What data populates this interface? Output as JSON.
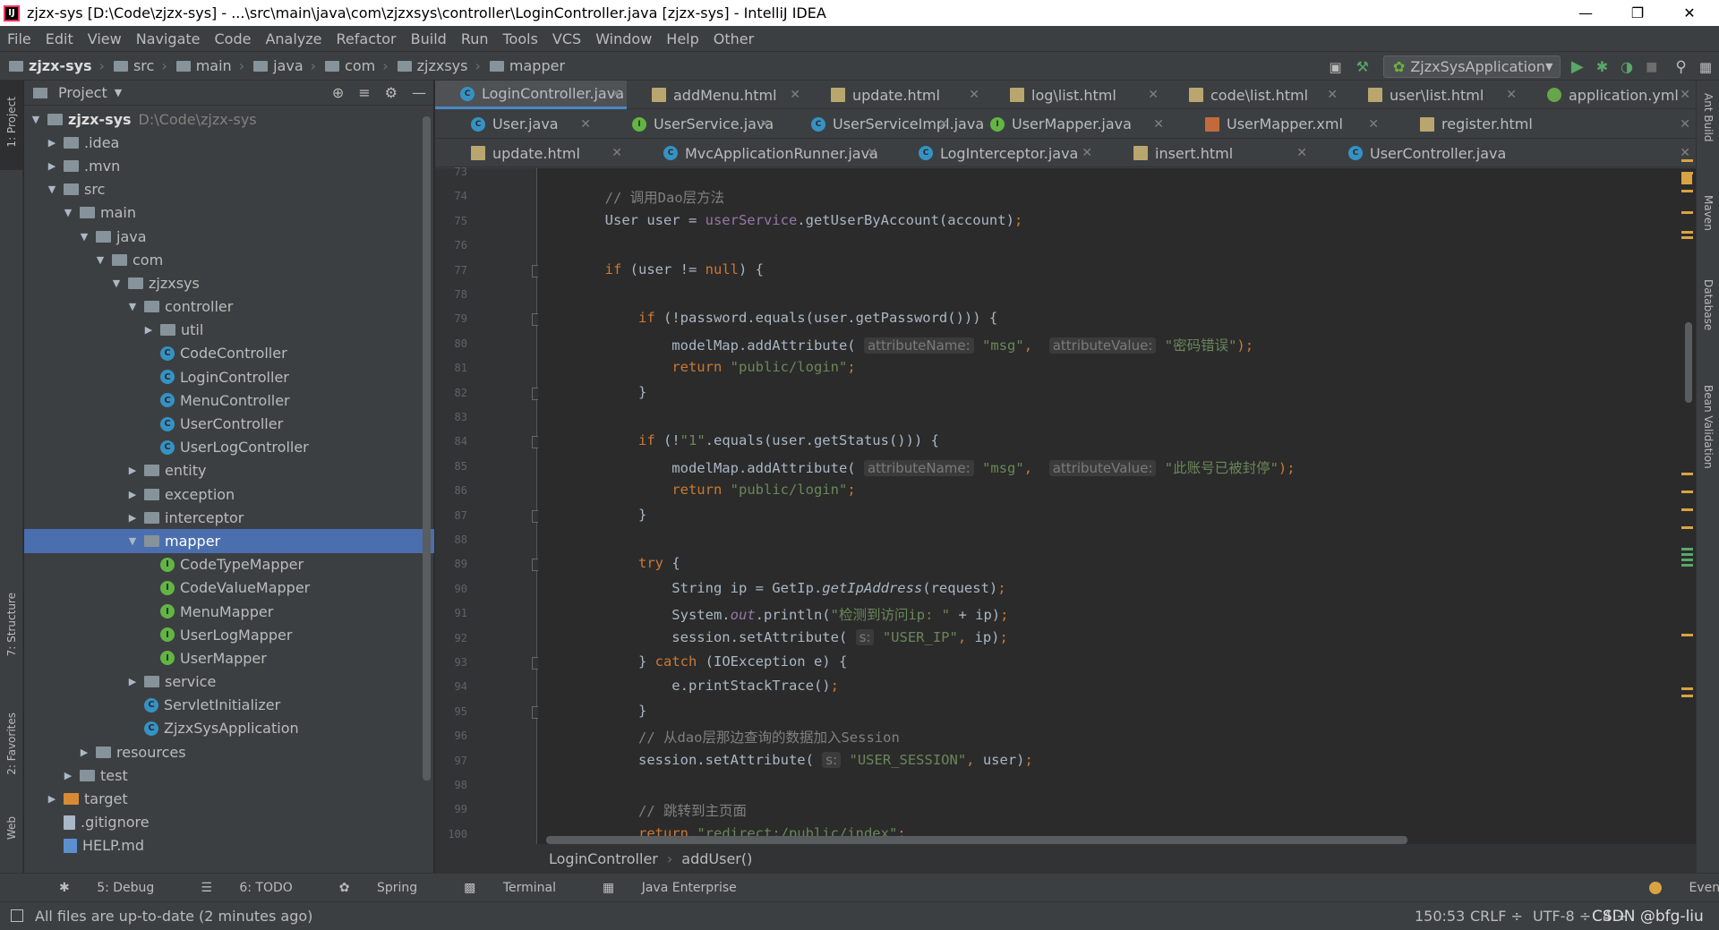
{
  "window": {
    "title": "zjzx-sys [D:\\Code\\zjzx-sys] - ...\\src\\main\\java\\com\\zjzxsys\\controller\\LoginController.java [zjzx-sys] - IntelliJ IDEA",
    "app_logo": "IJ"
  },
  "menu": [
    "File",
    "Edit",
    "View",
    "Navigate",
    "Code",
    "Analyze",
    "Refactor",
    "Build",
    "Run",
    "Tools",
    "VCS",
    "Window",
    "Help",
    "Other"
  ],
  "breadcrumb": [
    "zjzx-sys",
    "src",
    "main",
    "java",
    "com",
    "zjzxsys",
    "mapper"
  ],
  "run_config": "ZjzxSysApplication",
  "left_strip": [
    "1: Project",
    "7: Structure",
    "2: Favorites",
    "Web"
  ],
  "right_strip": [
    "Ant Build",
    "Maven",
    "Database",
    "Bean Validation"
  ],
  "project": {
    "title": "Project",
    "tree": [
      {
        "label": "zjzx-sys",
        "sub": "D:\\Code\\zjzx-sys",
        "arrow": "▼",
        "icon": "folder",
        "bold": true
      },
      {
        "label": ".idea",
        "arrow": "▶",
        "icon": "folder"
      },
      {
        "label": ".mvn",
        "arrow": "▶",
        "icon": "folder"
      },
      {
        "label": "src",
        "arrow": "▼",
        "icon": "folder"
      },
      {
        "label": "main",
        "arrow": "▼",
        "icon": "folder"
      },
      {
        "label": "java",
        "arrow": "▼",
        "icon": "folder"
      },
      {
        "label": "com",
        "arrow": "▼",
        "icon": "folder"
      },
      {
        "label": "zjzxsys",
        "arrow": "▼",
        "icon": "folder"
      },
      {
        "label": "controller",
        "arrow": "▼",
        "icon": "folder"
      },
      {
        "label": "util",
        "arrow": "▶",
        "icon": "folder"
      },
      {
        "label": "CodeController",
        "arrow": "",
        "icon": "cls"
      },
      {
        "label": "LoginController",
        "arrow": "",
        "icon": "cls"
      },
      {
        "label": "MenuController",
        "arrow": "",
        "icon": "cls"
      },
      {
        "label": "UserController",
        "arrow": "",
        "icon": "cls"
      },
      {
        "label": "UserLogController",
        "arrow": "",
        "icon": "cls"
      },
      {
        "label": "entity",
        "arrow": "▶",
        "icon": "folder"
      },
      {
        "label": "exception",
        "arrow": "▶",
        "icon": "folder"
      },
      {
        "label": "interceptor",
        "arrow": "▶",
        "icon": "folder"
      },
      {
        "label": "mapper",
        "arrow": "▼",
        "icon": "folder",
        "selected": true
      },
      {
        "label": "CodeTypeMapper",
        "arrow": "",
        "icon": "intf"
      },
      {
        "label": "CodeValueMapper",
        "arrow": "",
        "icon": "intf"
      },
      {
        "label": "MenuMapper",
        "arrow": "",
        "icon": "intf"
      },
      {
        "label": "UserLogMapper",
        "arrow": "",
        "icon": "intf"
      },
      {
        "label": "UserMapper",
        "arrow": "",
        "icon": "intf"
      },
      {
        "label": "service",
        "arrow": "▶",
        "icon": "folder"
      },
      {
        "label": "ServletInitializer",
        "arrow": "",
        "icon": "cls"
      },
      {
        "label": "ZjzxSysApplication",
        "arrow": "",
        "icon": "cls"
      },
      {
        "label": "resources",
        "arrow": "▶",
        "icon": "folder"
      },
      {
        "label": "test",
        "arrow": "▶",
        "icon": "folder"
      },
      {
        "label": "target",
        "arrow": "▶",
        "icon": "folder-orange"
      },
      {
        "label": ".gitignore",
        "arrow": "",
        "icon": "file"
      },
      {
        "label": "HELP.md",
        "arrow": "",
        "icon": "md"
      }
    ]
  },
  "tabs": [
    [
      {
        "label": "LoginController.java",
        "icon": "c",
        "active": true
      },
      {
        "label": "addMenu.html",
        "icon": "h"
      },
      {
        "label": "update.html",
        "icon": "h"
      },
      {
        "label": "log\\list.html",
        "icon": "h"
      },
      {
        "label": "code\\list.html",
        "icon": "h"
      },
      {
        "label": "user\\list.html",
        "icon": "h"
      },
      {
        "label": "application.yml",
        "icon": "y"
      }
    ],
    [
      {
        "label": "User.java",
        "icon": "c"
      },
      {
        "label": "UserService.java",
        "icon": "i"
      },
      {
        "label": "UserServiceImpl.java",
        "icon": "c"
      },
      {
        "label": "UserMapper.java",
        "icon": "i"
      },
      {
        "label": "UserMapper.xml",
        "icon": "x"
      },
      {
        "label": "register.html",
        "icon": "h"
      }
    ],
    [
      {
        "label": "update.html",
        "icon": "h"
      },
      {
        "label": "MvcApplicationRunner.java",
        "icon": "c"
      },
      {
        "label": "LogInterceptor.java",
        "icon": "c"
      },
      {
        "label": "insert.html",
        "icon": "h"
      },
      {
        "label": "UserController.java",
        "icon": "c"
      }
    ]
  ],
  "editor": {
    "line_numbers": [
      "73",
      "74",
      "75",
      "76",
      "77",
      "78",
      "79",
      "80",
      "81",
      "82",
      "83",
      "84",
      "85",
      "86",
      "87",
      "88",
      "89",
      "90",
      "91",
      "92",
      "93",
      "94",
      "95",
      "96",
      "97",
      "98",
      "99",
      "100"
    ],
    "lines": [
      [],
      [
        {
          "t": "        "
        },
        {
          "t": "// 调用Dao层方法",
          "c": "cm"
        }
      ],
      [
        {
          "t": "        User user = "
        },
        {
          "t": "userService",
          "c": "fi"
        },
        {
          "t": ".getUserByAccount(account)"
        },
        {
          "t": ";",
          "c": "kw"
        }
      ],
      [],
      [
        {
          "t": "        "
        },
        {
          "t": "if",
          "c": "kw"
        },
        {
          "t": " (user != "
        },
        {
          "t": "null",
          "c": "kw"
        },
        {
          "t": ") {"
        }
      ],
      [],
      [
        {
          "t": "            "
        },
        {
          "t": "if",
          "c": "kw"
        },
        {
          "t": " (!password.equals(user.getPassword())) {"
        }
      ],
      [
        {
          "t": "                modelMap.addAttribute( "
        },
        {
          "t": "attributeName:",
          "c": "hint"
        },
        {
          "t": " "
        },
        {
          "t": "\"msg\"",
          "c": "st"
        },
        {
          "t": ",  ",
          "c": "kw"
        },
        {
          "t": "attributeValue:",
          "c": "hint"
        },
        {
          "t": " "
        },
        {
          "t": "\"密码错误\"",
          "c": "st"
        },
        {
          "t": ");",
          "c": "kw"
        }
      ],
      [
        {
          "t": "                "
        },
        {
          "t": "return",
          "c": "kw"
        },
        {
          "t": " "
        },
        {
          "t": "\"public/login\"",
          "c": "st"
        },
        {
          "t": ";",
          "c": "kw"
        }
      ],
      [
        {
          "t": "            }"
        }
      ],
      [],
      [
        {
          "t": "            "
        },
        {
          "t": "if",
          "c": "kw"
        },
        {
          "t": " (!"
        },
        {
          "t": "\"1\"",
          "c": "st"
        },
        {
          "t": ".equals(user.getStatus())) {"
        }
      ],
      [
        {
          "t": "                modelMap.addAttribute( "
        },
        {
          "t": "attributeName:",
          "c": "hint"
        },
        {
          "t": " "
        },
        {
          "t": "\"msg\"",
          "c": "st"
        },
        {
          "t": ",  ",
          "c": "kw"
        },
        {
          "t": "attributeValue:",
          "c": "hint"
        },
        {
          "t": " "
        },
        {
          "t": "\"此账号已被封停\"",
          "c": "st"
        },
        {
          "t": ");",
          "c": "kw"
        }
      ],
      [
        {
          "t": "                "
        },
        {
          "t": "return",
          "c": "kw"
        },
        {
          "t": " "
        },
        {
          "t": "\"public/login\"",
          "c": "st"
        },
        {
          "t": ";",
          "c": "kw"
        }
      ],
      [
        {
          "t": "            }"
        }
      ],
      [],
      [
        {
          "t": "            "
        },
        {
          "t": "try",
          "c": "kw"
        },
        {
          "t": " {"
        }
      ],
      [
        {
          "t": "                String ip = GetIp."
        },
        {
          "t": "getIpAddress",
          "c": "it"
        },
        {
          "t": "(request)"
        },
        {
          "t": ";",
          "c": "kw"
        }
      ],
      [
        {
          "t": "                System."
        },
        {
          "t": "out",
          "c": "fi it"
        },
        {
          "t": ".println("
        },
        {
          "t": "\"检测到访问ip: \"",
          "c": "st"
        },
        {
          "t": " + ip)"
        },
        {
          "t": ";",
          "c": "kw"
        }
      ],
      [
        {
          "t": "                session.setAttribute( "
        },
        {
          "t": "s:",
          "c": "hint"
        },
        {
          "t": " "
        },
        {
          "t": "\"USER_IP\"",
          "c": "st"
        },
        {
          "t": ", ",
          "c": "kw"
        },
        {
          "t": "ip)"
        },
        {
          "t": ";",
          "c": "kw"
        }
      ],
      [
        {
          "t": "            } "
        },
        {
          "t": "catch",
          "c": "kw"
        },
        {
          "t": " (IOException e) {"
        }
      ],
      [
        {
          "t": "                e.printStackTrace()"
        },
        {
          "t": ";",
          "c": "kw"
        }
      ],
      [
        {
          "t": "            }"
        }
      ],
      [
        {
          "t": "            "
        },
        {
          "t": "// 从dao层那边查询的数据加入Session",
          "c": "cm"
        }
      ],
      [
        {
          "t": "            session.setAttribute( "
        },
        {
          "t": "s:",
          "c": "hint"
        },
        {
          "t": " "
        },
        {
          "t": "\"USER_SESSION\"",
          "c": "st"
        },
        {
          "t": ", ",
          "c": "kw"
        },
        {
          "t": "user)"
        },
        {
          "t": ";",
          "c": "kw"
        }
      ],
      [],
      [
        {
          "t": "            "
        },
        {
          "t": "// 跳转到主页面",
          "c": "cm"
        }
      ],
      [
        {
          "t": "            "
        },
        {
          "t": "return",
          "c": "kw"
        },
        {
          "t": " "
        },
        {
          "t": "\"redirect:/public/index\"",
          "c": "st"
        },
        {
          "t": ";",
          "c": "kw"
        }
      ]
    ]
  },
  "code_breadcrumb": [
    "LoginController",
    "addUser()"
  ],
  "tool_windows": [
    "5: Debug",
    "6: TODO",
    "Spring",
    "Terminal",
    "Java Enterprise"
  ],
  "event_log": "Event Log",
  "status": {
    "message": "All files are up-to-date (2 minutes ago)",
    "position": "150:53",
    "line_sep": "CRLF ÷",
    "encoding": "UTF-8 ÷",
    "extra": "4 ÷",
    "watermark": "CSDN @bfg-liu"
  },
  "colors": {
    "accent": "#4a88c7",
    "selection": "#4b6eaf",
    "keyword": "#cc7832",
    "string": "#6a8759",
    "comment": "#808080",
    "field": "#9876aa"
  }
}
